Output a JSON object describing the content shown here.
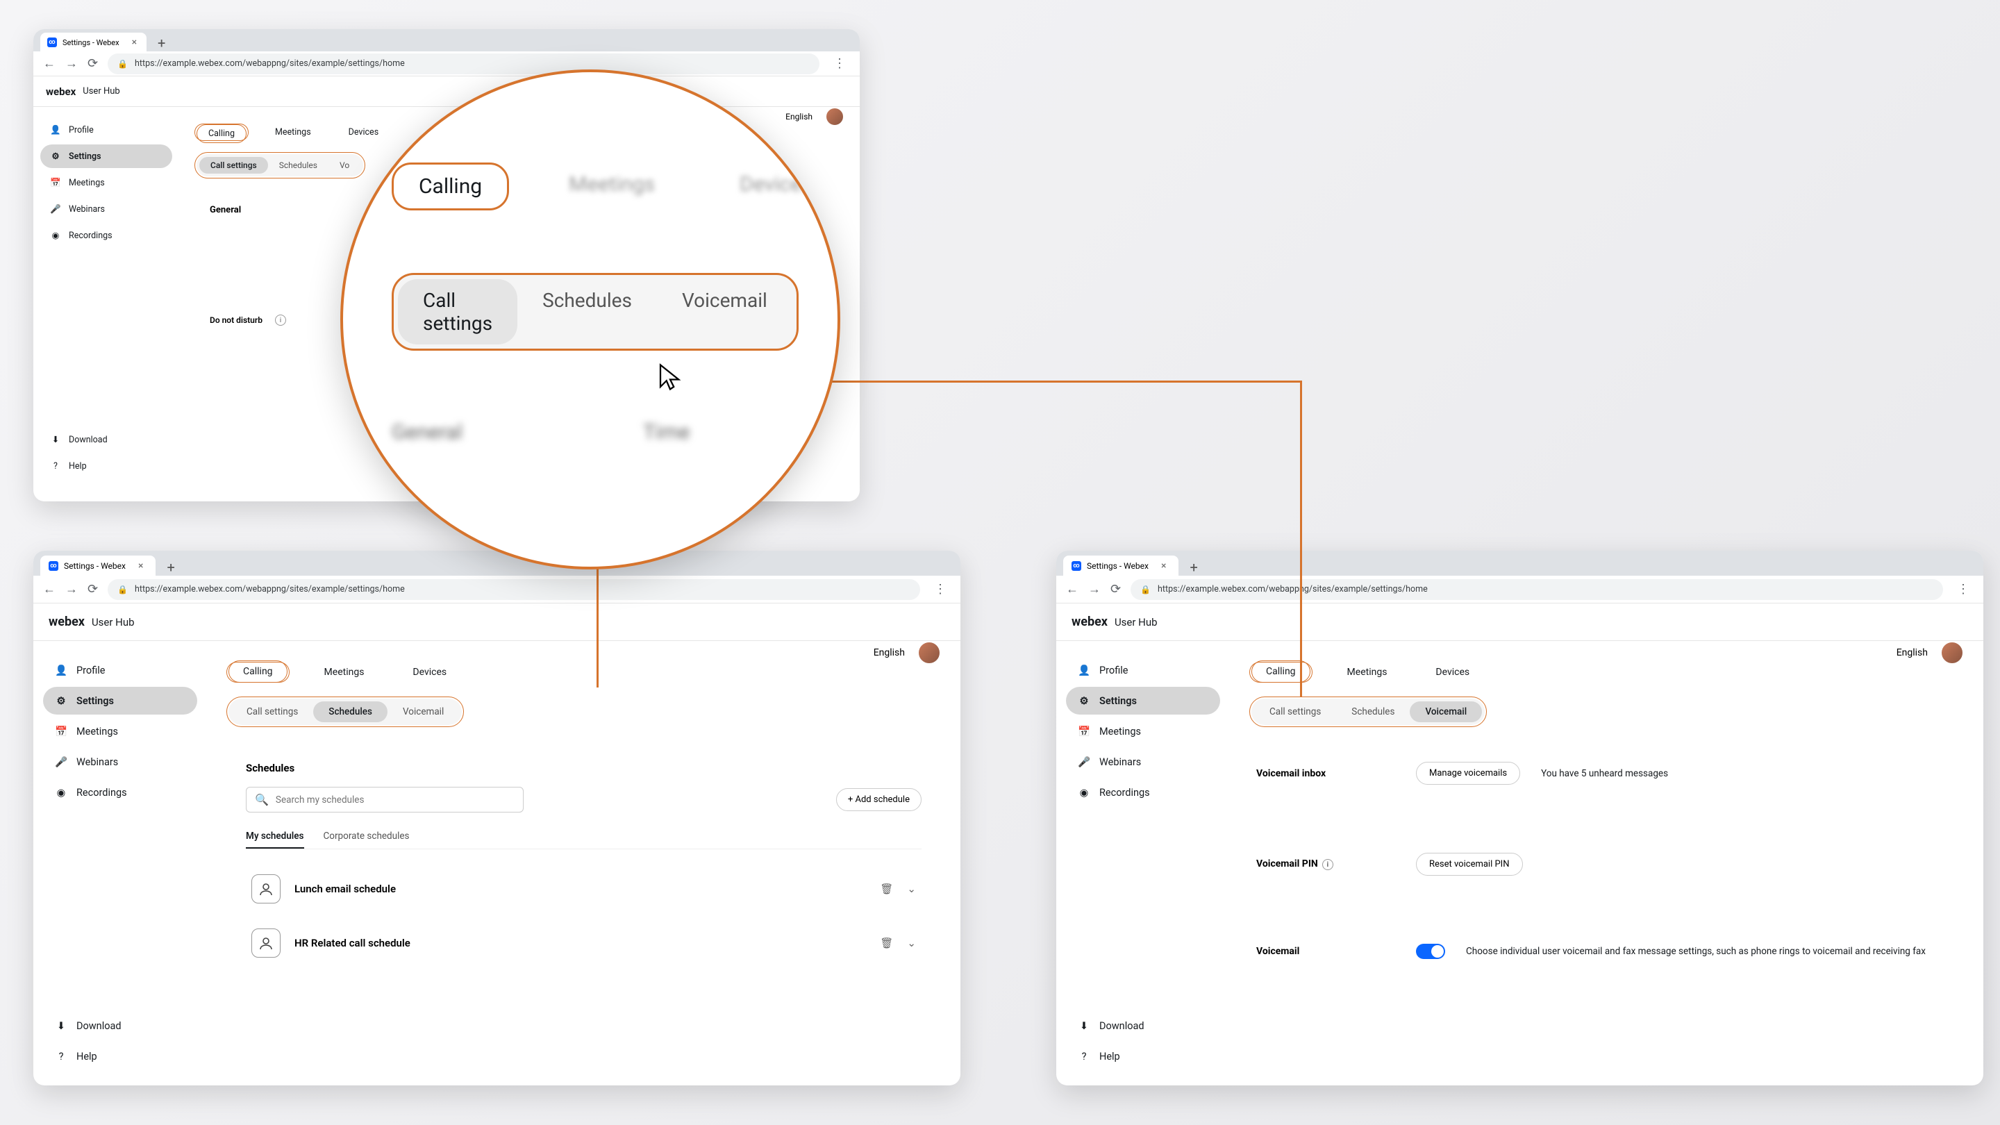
{
  "browser": {
    "tab_title": "Settings - Webex",
    "url": "https://example.webex.com/webappng/sites/example/settings/home"
  },
  "app": {
    "brand": "webex",
    "hub": "User Hub",
    "language": "English"
  },
  "sidebar": {
    "items": [
      {
        "label": "Profile"
      },
      {
        "label": "Settings"
      },
      {
        "label": "Meetings"
      },
      {
        "label": "Webinars"
      },
      {
        "label": "Recordings"
      }
    ],
    "download": "Download",
    "help": "Help"
  },
  "tabs": {
    "primary": [
      {
        "label": "Calling"
      },
      {
        "label": "Meetings"
      },
      {
        "label": "Devices"
      }
    ],
    "secondary": [
      {
        "label": "Call settings"
      },
      {
        "label": "Schedules"
      },
      {
        "label": "Voicemail"
      }
    ]
  },
  "win1": {
    "general": "General",
    "dnd": "Do not disturb"
  },
  "zoom": {
    "general": "General",
    "time": "Time"
  },
  "schedules": {
    "title": "Schedules",
    "search_ph": "Search my schedules",
    "add": "Add schedule",
    "tabs": [
      {
        "label": "My schedules"
      },
      {
        "label": "Corporate schedules"
      }
    ],
    "items": [
      {
        "name": "Lunch email schedule"
      },
      {
        "name": "HR Related call schedule"
      }
    ]
  },
  "voicemail": {
    "inbox_label": "Voicemail inbox",
    "manage": "Manage voicemails",
    "status": "You have 5 unheard messages",
    "pin_label": "Voicemail PIN",
    "reset": "Reset voicemail PIN",
    "vm_label": "Voicemail",
    "desc": "Choose individual user voicemail and fax message settings, such as phone rings to voicemail and receiving fax"
  }
}
